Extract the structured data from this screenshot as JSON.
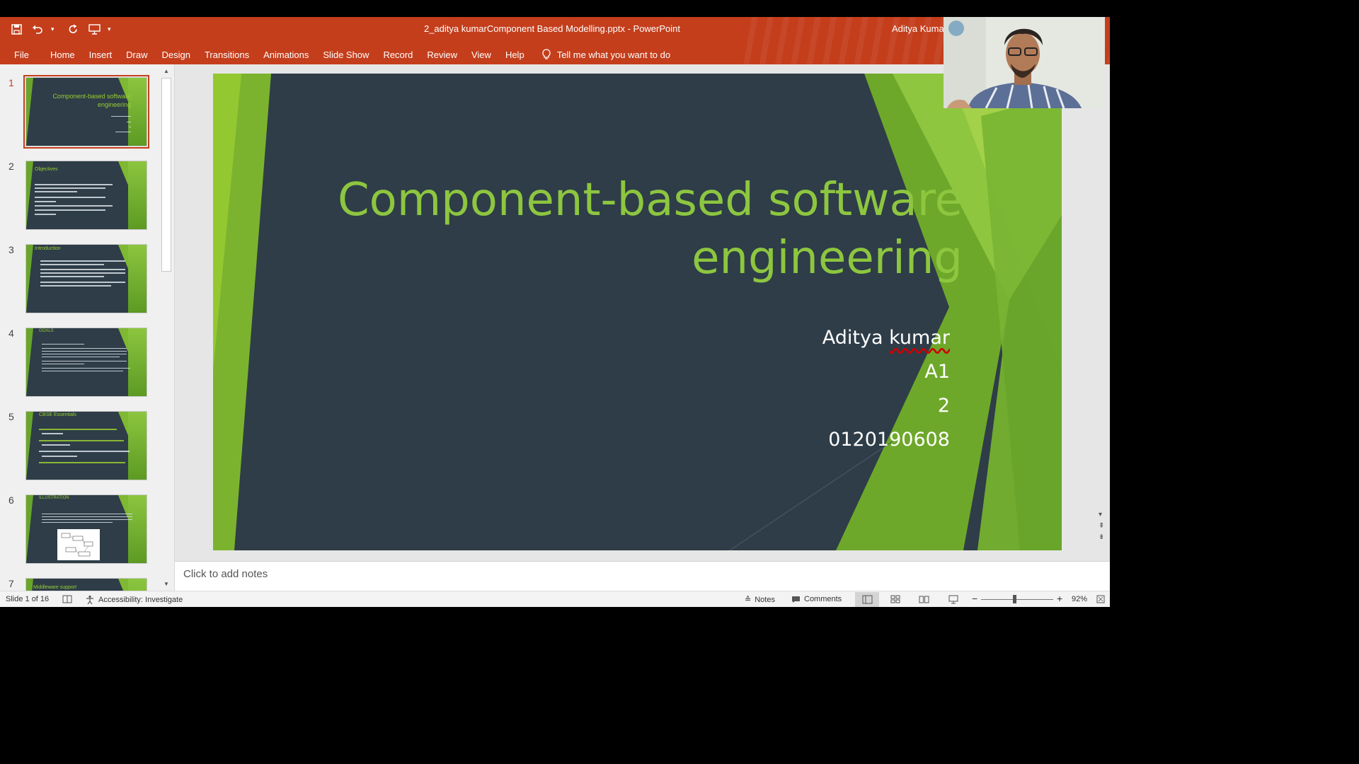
{
  "window": {
    "doc_title": "2_aditya kumarComponent Based Modelling.pptx  -  PowerPoint",
    "user": "Aditya Kumar"
  },
  "qat": {
    "save_icon": "save-icon",
    "undo_icon": "undo-icon",
    "redo_icon": "repeat-icon",
    "present_icon": "present-from-start-icon",
    "customize_icon": "customize-qat-icon"
  },
  "tabs": [
    "File",
    "Home",
    "Insert",
    "Draw",
    "Design",
    "Transitions",
    "Animations",
    "Slide Show",
    "Record",
    "Review",
    "View",
    "Help"
  ],
  "tell_me": "Tell me what you want to do",
  "thumbnails": [
    {
      "num": "1",
      "title": "Component-based software engineering"
    },
    {
      "num": "2",
      "title": "Objectives"
    },
    {
      "num": "3",
      "title": "Introduction"
    },
    {
      "num": "4",
      "title": "GOALS"
    },
    {
      "num": "5",
      "title": "CBSE Essentials"
    },
    {
      "num": "6",
      "title": "ILLUSTRATION"
    },
    {
      "num": "7",
      "title": "Middleware support"
    }
  ],
  "slide": {
    "title_line1": "Component-based software",
    "title_line2": "engineering",
    "name_first": "Aditya ",
    "name_last": "kumar",
    "line2": "A1",
    "line3": "2",
    "line4": "0120190608"
  },
  "notes_placeholder": "Click to add notes",
  "status": {
    "slide_info": "Slide 1 of 16",
    "accessibility": "Accessibility: Investigate",
    "notes": "Notes",
    "comments": "Comments",
    "zoom": "92%"
  },
  "colors": {
    "ribbon": "#c43e1c",
    "slide_bg": "#2e3d48",
    "accent_green": "#8dc63f"
  }
}
